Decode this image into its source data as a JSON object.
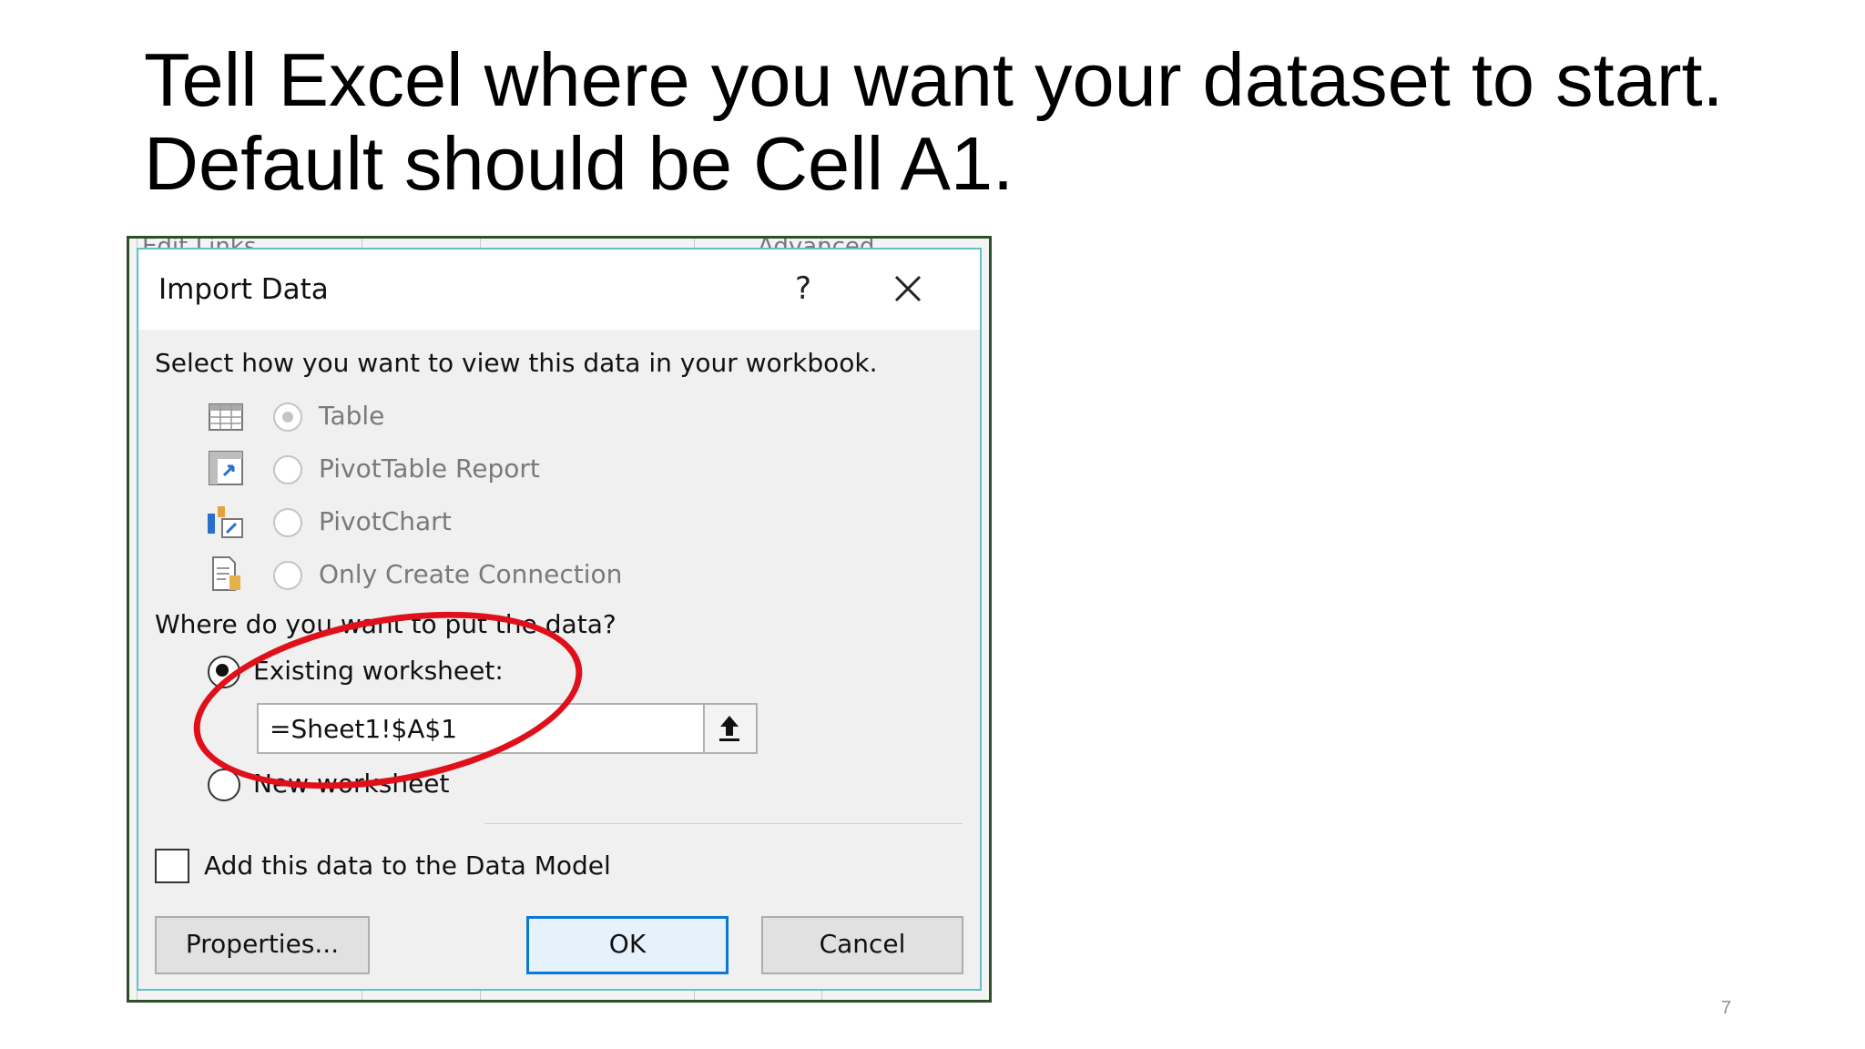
{
  "slide": {
    "title": "Tell Excel where you want your dataset to start. Default should be Cell A1.",
    "page_number": "7"
  },
  "background": {
    "left_text": "Edit Links",
    "right_text": "Advanced"
  },
  "dialog": {
    "title": "Import Data",
    "help_label": "?",
    "view_prompt": "Select how you want to view this data in your workbook.",
    "view_options": [
      {
        "label": "Table",
        "icon": "table-icon",
        "selected": true,
        "enabled": false
      },
      {
        "label": "PivotTable Report",
        "icon": "pivottable-icon",
        "selected": false,
        "enabled": false
      },
      {
        "label": "PivotChart",
        "icon": "pivotchart-icon",
        "selected": false,
        "enabled": false
      },
      {
        "label": "Only Create Connection",
        "icon": "connection-icon",
        "selected": false,
        "enabled": false
      }
    ],
    "location_prompt": "Where do you want to put the data?",
    "existing_worksheet_label": "Existing worksheet:",
    "existing_worksheet_selected": true,
    "cell_reference": "=Sheet1!$A$1",
    "new_worksheet_label": "New worksheet",
    "data_model_label": "Add this data to the Data Model",
    "data_model_checked": false,
    "properties_label": "Properties...",
    "ok_label": "OK",
    "cancel_label": "Cancel"
  },
  "colors": {
    "annotation": "#e0101a",
    "primary_button_border": "#0a78d7",
    "dialog_border": "#5fc0c8"
  }
}
